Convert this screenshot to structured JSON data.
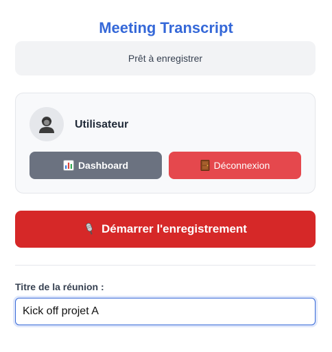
{
  "app": {
    "title": "Meeting Transcript"
  },
  "status": {
    "text": "Prêt à enregistrer"
  },
  "user": {
    "name": "Utilisateur",
    "avatar_icon": "user-silhouette-icon",
    "dashboard_label": "Dashboard",
    "dashboard_icon": "bar-chart-icon",
    "logout_label": "Déconnexion",
    "logout_icon": "door-icon"
  },
  "recording": {
    "start_label": "Démarrer l'enregistrement",
    "icon": "microphone-icon"
  },
  "meeting": {
    "title_label": "Titre de la réunion :",
    "title_value": "Kick off projet A"
  },
  "colors": {
    "accent": "#3568d8",
    "record": "#d62828",
    "logout": "#e5484d",
    "dashboard": "#6b7280"
  }
}
